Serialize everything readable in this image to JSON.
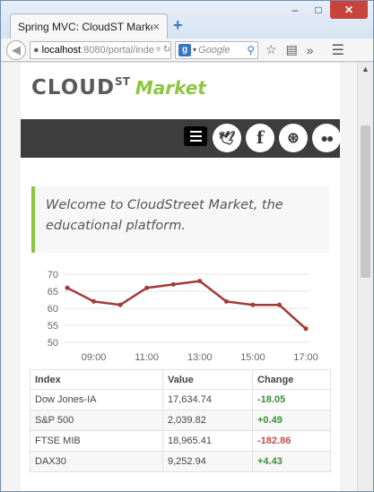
{
  "browser": {
    "tab_title": "Spring MVC: CloudST Market",
    "tab_close": "×",
    "new_tab": "+",
    "win_minimize": "–",
    "win_maximize": "□",
    "win_close": "✕",
    "url_host": "localhost",
    "url_path": ":8080/portal/inde",
    "search_placeholder": "Google",
    "search_engine": "g"
  },
  "brand": {
    "cloud": "CLOUD",
    "st": "ST",
    "market": "Market"
  },
  "accent_color": "#8cc63f",
  "welcome_text": "Welcome to CloudStreet Market, the educational platform.",
  "chart_data": {
    "type": "line",
    "x": [
      "08:00",
      "09:00",
      "10:00",
      "11:00",
      "12:00",
      "13:00",
      "14:00",
      "15:00",
      "16:00",
      "17:00"
    ],
    "xtick_labels": [
      "09:00",
      "11:00",
      "13:00",
      "15:00",
      "17:00"
    ],
    "ytick_labels": [
      "70",
      "65",
      "60",
      "55",
      "50"
    ],
    "values": [
      66,
      62,
      61,
      66,
      67,
      68,
      62,
      61,
      61,
      54
    ],
    "ylim": [
      50,
      70
    ],
    "color": "#a33a3a"
  },
  "table": {
    "headers": [
      "Index",
      "Value",
      "Change"
    ],
    "rows": [
      {
        "index": "Dow Jones-IA",
        "value": "17,634.74",
        "change": "-18.05",
        "sign": "neg-green"
      },
      {
        "index": "S&P 500",
        "value": "2,039.82",
        "change": "+0.49",
        "sign": "pos"
      },
      {
        "index": "FTSE MIB",
        "value": "18,965.41",
        "change": "-182.86",
        "sign": "neg"
      },
      {
        "index": "DAX30",
        "value": "9,252.94",
        "change": "+4.43",
        "sign": "pos"
      }
    ]
  }
}
